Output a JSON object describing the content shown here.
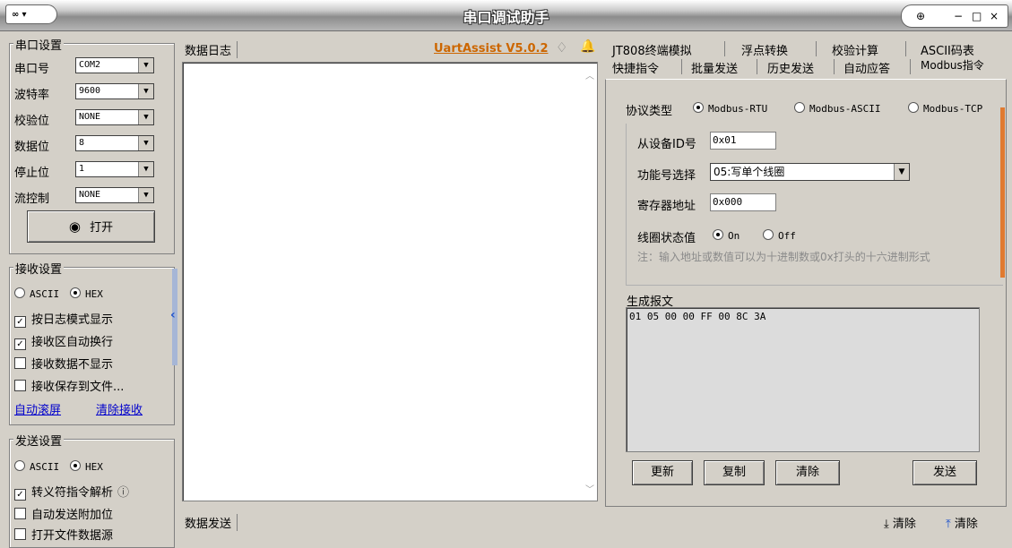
{
  "window": {
    "title": "串口调试助手",
    "menu_label": "▾",
    "controls": {
      "pin": "⊕",
      "min": "−",
      "max": "□",
      "close": "×"
    }
  },
  "serial": {
    "title": "串口设置",
    "fields": [
      {
        "label": "串口号",
        "value": "COM2"
      },
      {
        "label": "波特率",
        "value": "9600"
      },
      {
        "label": "校验位",
        "value": "NONE"
      },
      {
        "label": "数据位",
        "value": "8"
      },
      {
        "label": "停止位",
        "value": "1"
      },
      {
        "label": "流控制",
        "value": "NONE"
      }
    ],
    "open_button": "打开"
  },
  "receive": {
    "title": "接收设置",
    "ascii": "ASCII",
    "hex": "HEX",
    "options": [
      {
        "label": "按日志模式显示",
        "checked": true
      },
      {
        "label": "接收区自动换行",
        "checked": true
      },
      {
        "label": "接收数据不显示",
        "checked": false
      },
      {
        "label": "接收保存到文件...",
        "checked": false
      }
    ],
    "auto_scroll": "自动滚屏",
    "clear": "清除接收"
  },
  "send": {
    "title": "发送设置",
    "ascii": "ASCII",
    "hex": "HEX",
    "options": [
      {
        "label": "转义符指令解析",
        "checked": true
      },
      {
        "label": "自动发送附加位",
        "checked": false
      },
      {
        "label": "打开文件数据源",
        "checked": false
      }
    ],
    "info_icon": "ⓘ"
  },
  "log": {
    "tab": "数据日志",
    "version": "UartAssist V5.0.2"
  },
  "data_send": {
    "tab": "数据发送",
    "clear1": "清除",
    "clear2": "清除"
  },
  "right": {
    "tabs_row1": [
      "JT808终端模拟",
      "浮点转换",
      "校验计算",
      "ASCII码表"
    ],
    "tabs_row2": [
      "快捷指令",
      "批量发送",
      "历史发送",
      "自动应答",
      "Modbus指令"
    ],
    "protocol_label": "协议类型",
    "protocols": [
      "Modbus-RTU",
      "Modbus-ASCII",
      "Modbus-TCP"
    ],
    "slave_label": "从设备ID号",
    "slave_value": "0x01",
    "func_label": "功能号选择",
    "func_value": "05:写单个线圈",
    "reg_label": "寄存器地址",
    "reg_value": "0x000",
    "coil_label": "线圈状态值",
    "coil_on": "On",
    "coil_off": "Off",
    "note": "注：输入地址或数值可以为十进制数或0x打头的十六进制形式",
    "gen_label": "生成报文",
    "gen_value": "01 05 00 00 FF 00 8C 3A",
    "btn_update": "更新",
    "btn_copy": "复制",
    "btn_clear": "清除",
    "btn_send": "发送"
  }
}
